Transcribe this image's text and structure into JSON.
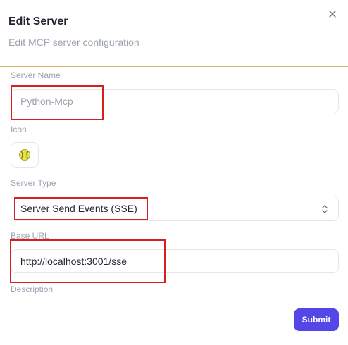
{
  "dialog": {
    "title": "Edit Server",
    "subtitle": "Edit MCP server configuration",
    "close_icon": "close-icon"
  },
  "form": {
    "server_name": {
      "label": "Server Name",
      "value": "",
      "placeholder": "Python-Mcp"
    },
    "icon": {
      "label": "Icon",
      "value": "🥎",
      "icon_name": "softball-icon"
    },
    "server_type": {
      "label": "Server Type",
      "selected": "Server Send Events (SSE)"
    },
    "base_url": {
      "label": "Base URL",
      "value": "http://localhost:3001/sse"
    },
    "description": {
      "label": "Description"
    }
  },
  "footer": {
    "submit_label": "Submit"
  },
  "colors": {
    "accent": "#5546e8",
    "divider": "#e0b563",
    "highlight": "#d62020"
  }
}
